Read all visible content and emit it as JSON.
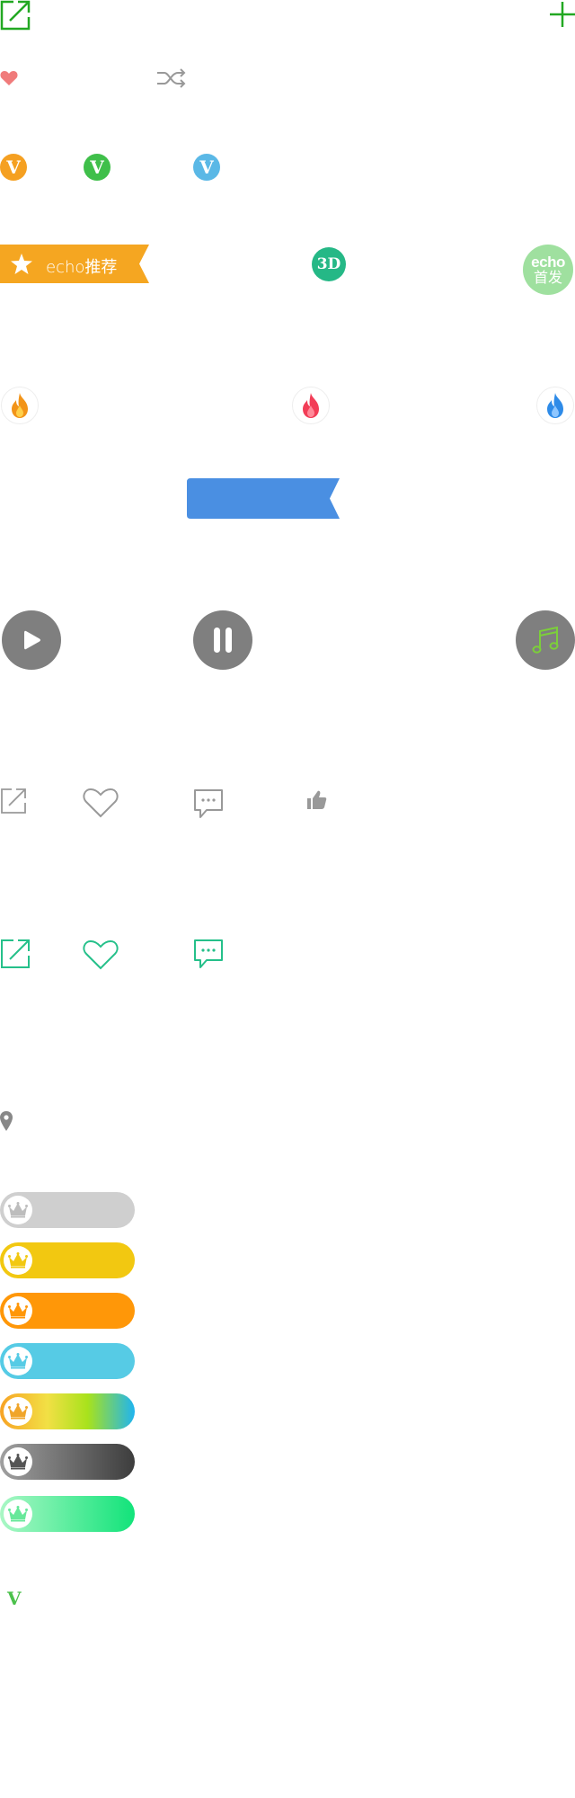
{
  "colors": {
    "green_accent": "#22a822",
    "teal": "#25c08a",
    "gray_icon": "#999999",
    "heart_pink": "#f07b7b",
    "orange": "#f5a021",
    "blue_banner": "#4a8fe2",
    "player_gray": "#7f7f7f",
    "echo_green": "#9fe09f"
  },
  "icons": {
    "top": [
      "share-outline-icon",
      "plus-icon"
    ],
    "small": [
      "heart-filled-icon",
      "shuffle-icon"
    ],
    "verified": [
      "v-badge-orange",
      "v-badge-green",
      "v-badge-blue"
    ],
    "fire": [
      "fire-orange-icon",
      "fire-red-icon",
      "fire-blue-icon"
    ],
    "player": [
      "play-button",
      "pause-button",
      "music-note-button"
    ],
    "actions_gray": [
      "share-icon",
      "heart-outline-icon",
      "comment-icon",
      "thumbs-up-icon"
    ],
    "actions_teal": [
      "share-icon",
      "heart-outline-icon",
      "comment-icon"
    ],
    "misc": [
      "location-pin-icon",
      "small-v-icon"
    ]
  },
  "verified_badges": {
    "letter": "V",
    "colors": [
      "#f5a021",
      "#3fbf4a",
      "#5ab8e6"
    ]
  },
  "recommend_ribbon": {
    "label": "echo推荐",
    "color": "#f5a621"
  },
  "badge_3d": {
    "label": "3D",
    "color": "#25b886"
  },
  "echo_first": {
    "line1": "echo",
    "line2": "首发",
    "color": "#9fe09f"
  },
  "vip_pills": [
    {
      "name": "gray",
      "bg": "#cfcfcf",
      "crown": "#bdbdbd"
    },
    {
      "name": "yellow",
      "bg": "#f2c811",
      "crown": "#f2c811"
    },
    {
      "name": "orange",
      "bg": "#ff9708",
      "crown": "#ff9708"
    },
    {
      "name": "blue",
      "bg": "#56cbe5",
      "crown": "#56cbe5"
    },
    {
      "name": "rainbow",
      "bg": "linear-gradient(90deg,#f7a325 0%,#f2e045 35%,#a8e21c 65%,#1fb4f0 100%)",
      "crown": "#f0a52a"
    },
    {
      "name": "dark",
      "bg": "linear-gradient(90deg,#a0a0a0 0%,#3d3d3d 100%)",
      "crown": "#555555"
    },
    {
      "name": "green",
      "bg": "linear-gradient(90deg,#aaf7c5 0%,#12e37a 100%)",
      "crown": "#67e89a"
    }
  ]
}
